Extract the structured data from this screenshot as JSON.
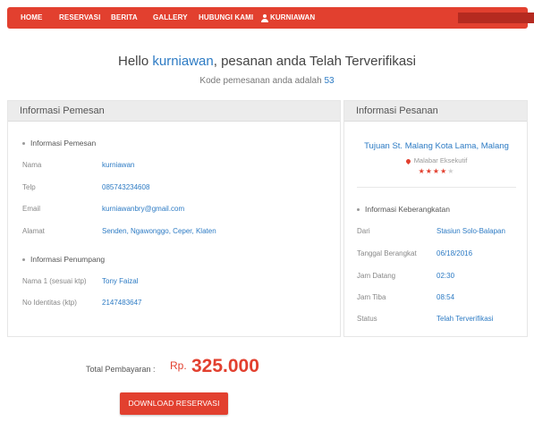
{
  "nav": {
    "items": [
      "HOME",
      "RESERVASI",
      "BERITA",
      "GALLERY",
      "HUBUNGI KAMI"
    ],
    "user": "KURNIAWAN"
  },
  "greeting": {
    "hello": "Hello",
    "name": "kurniawan",
    "rest": ", pesanan anda Telah Terverifikasi",
    "code_text": "Kode pemesanan anda adalah",
    "code": "53"
  },
  "pemesan": {
    "header": "Informasi Pemesan",
    "section": "Informasi Pemesan",
    "fields": [
      {
        "label": "Nama",
        "value": "kurniawan"
      },
      {
        "label": "Telp",
        "value": "085743234608"
      },
      {
        "label": "Email",
        "value": "kurniawanbry@gmail.com"
      },
      {
        "label": "Alamat",
        "value": "Senden, Ngawonggo, Ceper, Klaten"
      }
    ],
    "penumpang_section": "Informasi Penumpang",
    "penumpang": [
      {
        "label": "Nama 1 (sesuai ktp)",
        "value": "Tony Faizal"
      },
      {
        "label": "No Identitas (ktp)",
        "value": "2147483647"
      }
    ]
  },
  "pesanan": {
    "header": "Informasi Pesanan",
    "route": "Tujuan St. Malang Kota Lama, Malang",
    "train": "Malabar Eksekutif",
    "rating": 4,
    "rating_max": 5,
    "section": "Informasi Keberangkatan",
    "fields": [
      {
        "label": "Dari",
        "value": "Stasiun Solo-Balapan"
      },
      {
        "label": "Tanggal Berangkat",
        "value": "06/18/2016"
      },
      {
        "label": "Jam Datang",
        "value": "02:30"
      },
      {
        "label": "Jam Tiba",
        "value": "08:54"
      },
      {
        "label": "Status",
        "value": "Telah Terverifikasi"
      }
    ]
  },
  "payment": {
    "label": "Total Pembayaran :",
    "currency": "Rp.",
    "amount": "325.000",
    "button": "DOWNLOAD RESERVASI"
  },
  "colors": {
    "accent": "#e2402f",
    "link": "#2d7bc4",
    "panel_header": "#ececec"
  }
}
